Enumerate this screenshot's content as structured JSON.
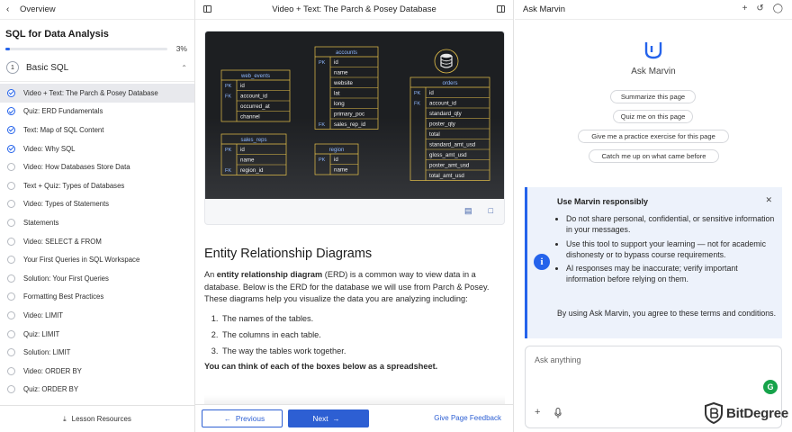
{
  "left": {
    "header": "Overview",
    "course_title": "SQL for Data Analysis",
    "progress": 3,
    "progress_label": "3%",
    "lesson_number": "1",
    "lesson_title": "Basic SQL",
    "items": [
      {
        "label": "Video + Text: The Parch & Posey Database",
        "done": true,
        "active": true
      },
      {
        "label": "Quiz: ERD Fundamentals",
        "done": true,
        "active": false
      },
      {
        "label": "Text: Map of SQL Content",
        "done": true,
        "active": false
      },
      {
        "label": "Video: Why SQL",
        "done": true,
        "active": false
      },
      {
        "label": "Video: How Databases Store Data",
        "done": false,
        "active": false
      },
      {
        "label": "Text + Quiz: Types of Databases",
        "done": false,
        "active": false
      },
      {
        "label": "Video: Types of Statements",
        "done": false,
        "active": false
      },
      {
        "label": "Statements",
        "done": false,
        "active": false
      },
      {
        "label": "Video: SELECT & FROM",
        "done": false,
        "active": false
      },
      {
        "label": "Your First Queries in SQL Workspace",
        "done": false,
        "active": false
      },
      {
        "label": "Solution: Your First Queries",
        "done": false,
        "active": false
      },
      {
        "label": "Formatting Best Practices",
        "done": false,
        "active": false
      },
      {
        "label": "Video: LIMIT",
        "done": false,
        "active": false
      },
      {
        "label": "Quiz: LIMIT",
        "done": false,
        "active": false
      },
      {
        "label": "Solution: LIMIT",
        "done": false,
        "active": false
      },
      {
        "label": "Video: ORDER BY",
        "done": false,
        "active": false
      },
      {
        "label": "Quiz: ORDER BY",
        "done": false,
        "active": false
      }
    ],
    "resources_label": "Lesson Resources"
  },
  "center": {
    "title": "Video + Text: The Parch & Posey Database",
    "erd": {
      "tables": [
        {
          "name": "web_events",
          "rows": [
            {
              "key": "PK",
              "col": "id"
            },
            {
              "key": "FK",
              "col": "account_id"
            },
            {
              "key": "",
              "col": "occurred_at"
            },
            {
              "key": "",
              "col": "channel"
            }
          ]
        },
        {
          "name": "accounts",
          "rows": [
            {
              "key": "PK",
              "col": "id"
            },
            {
              "key": "",
              "col": "name"
            },
            {
              "key": "",
              "col": "website"
            },
            {
              "key": "",
              "col": "lat"
            },
            {
              "key": "",
              "col": "long"
            },
            {
              "key": "",
              "col": "primary_poc"
            },
            {
              "key": "FK",
              "col": "sales_rep_id"
            }
          ]
        },
        {
          "name": "orders",
          "rows": [
            {
              "key": "PK",
              "col": "id"
            },
            {
              "key": "FK",
              "col": "account_id"
            },
            {
              "key": "",
              "col": "standard_qty"
            },
            {
              "key": "",
              "col": "poster_qty"
            },
            {
              "key": "",
              "col": "total"
            },
            {
              "key": "",
              "col": "standard_amt_usd"
            },
            {
              "key": "",
              "col": "gloss_amt_usd"
            },
            {
              "key": "",
              "col": "poster_amt_usd"
            },
            {
              "key": "",
              "col": "total_amt_usd"
            }
          ]
        },
        {
          "name": "sales_reps",
          "rows": [
            {
              "key": "PK",
              "col": "id"
            },
            {
              "key": "",
              "col": "name"
            },
            {
              "key": "FK",
              "col": "region_id"
            }
          ]
        },
        {
          "name": "region",
          "rows": [
            {
              "key": "PK",
              "col": "id"
            },
            {
              "key": "",
              "col": "name"
            }
          ]
        }
      ]
    },
    "heading": "Entity Relationship Diagrams",
    "para_prefix": "An ",
    "para_bold": "entity relationship diagram",
    "para_rest": " (ERD) is a common way to view data in a database. Below is the ERD for the database we will use from Parch & Posey. These diagrams help you visualize the data you are analyzing including:",
    "list": [
      "The names of the tables.",
      "The columns in each table.",
      "The way the tables work together."
    ],
    "bold_line": "You can think of each of the boxes below as a spreadsheet.",
    "prev_label": "Previous",
    "next_label": "Next",
    "feedback_label": "Give Page Feedback"
  },
  "right": {
    "title": "Ask Marvin",
    "marvin_title": "Ask Marvin",
    "chips": [
      "Summarize this page",
      "Quiz me on this page",
      "Give me a practice exercise for this page",
      "Catch me up on what came before"
    ],
    "notice_title": "Use Marvin responsibly",
    "notice_items": [
      "Do not share personal, confidential, or sensitive information in your messages.",
      "Use this tool to support your learning — not for academic dishonesty or to bypass course requirements.",
      "AI responses may be inaccurate; verify important information before relying on them."
    ],
    "notice_footer": "By using Ask Marvin, you agree to these terms and conditions.",
    "input_placeholder": "Ask anything",
    "brand": "BitDegree"
  },
  "colors": {
    "accent": "#2563eb",
    "erd_bg": "#1d1f22",
    "erd_header": "#8fb8ff",
    "erd_key": "#c9a227",
    "notice_bg": "#edf2fb"
  }
}
